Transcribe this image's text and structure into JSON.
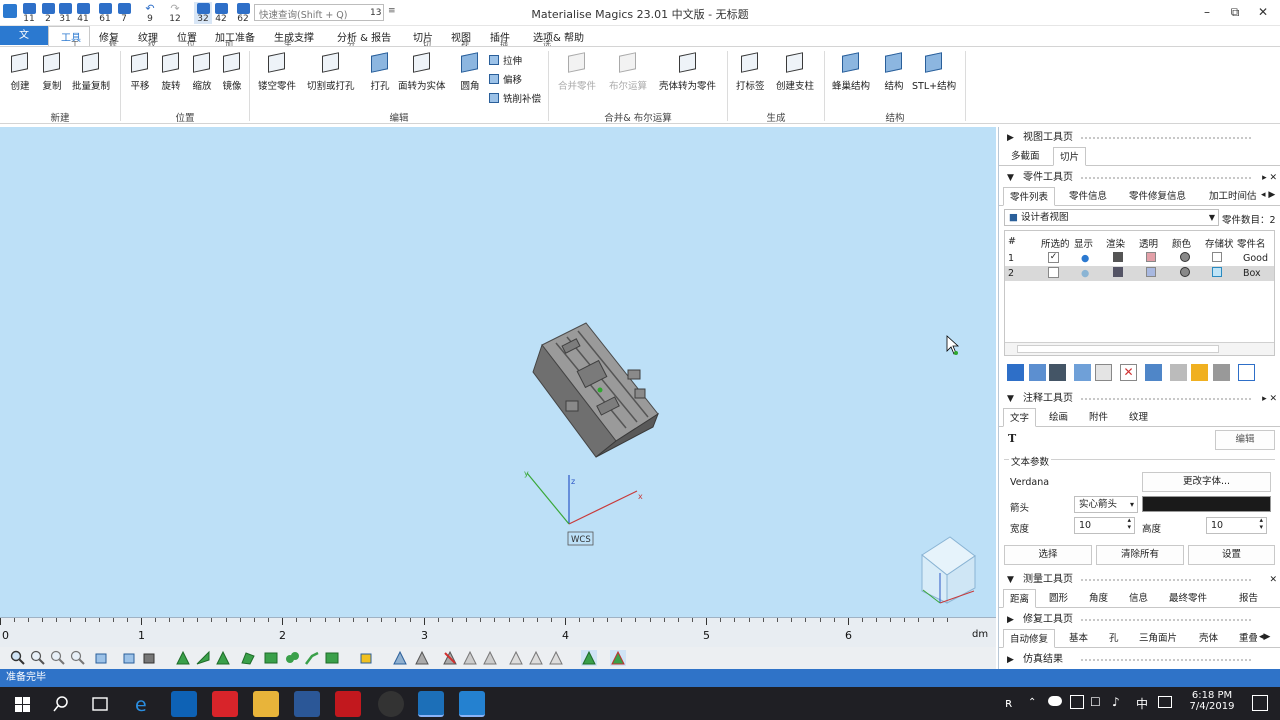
{
  "app": {
    "title": "Materialise Magics 23.01 中文版 - 无标题"
  },
  "quick_access": {
    "badges": [
      "11",
      "2",
      "31",
      "41",
      "61",
      "7",
      "9",
      "12",
      "32",
      "42",
      "62"
    ],
    "search_placeholder": "快速查询(Shift + Q)",
    "search_badge": "13"
  },
  "window_controls": {
    "minimize": "–",
    "restore": "⧉",
    "close": "✕"
  },
  "tabs": [
    {
      "label": "文",
      "accel": ""
    },
    {
      "label": "工具",
      "accel": "工"
    },
    {
      "label": "修复",
      "accel": "修"
    },
    {
      "label": "纹理",
      "accel": "纹"
    },
    {
      "label": "位置",
      "accel": "位"
    },
    {
      "label": "加工准备",
      "accel": "加"
    },
    {
      "label": "生成支撑",
      "accel": "生"
    },
    {
      "label": "分析 & 报告",
      "accel": "分"
    },
    {
      "label": "切片",
      "accel": "切"
    },
    {
      "label": "视图",
      "accel": "视"
    },
    {
      "label": "插件",
      "accel": "插"
    },
    {
      "label": "选项& 帮助",
      "accel": "选"
    }
  ],
  "ribbon": {
    "new_group": {
      "label": "新建",
      "buttons": [
        "创建",
        "复制",
        "批量复制"
      ]
    },
    "position_group": {
      "label": "位置",
      "buttons": [
        "平移",
        "旋转",
        "缩放",
        "镜像"
      ]
    },
    "edit_group": {
      "label": "编辑",
      "buttons": [
        "镂空零件",
        "切割或打孔",
        "打孔",
        "面转为实体",
        "圆角"
      ],
      "small_buttons": [
        "拉伸",
        "偏移",
        "铣削补偿"
      ]
    },
    "merge_group": {
      "label": "合并& 布尔运算",
      "buttons": [
        "合并零件",
        "布尔运算",
        "壳体转为零件"
      ]
    },
    "generate_group": {
      "label": "生成",
      "buttons": [
        "打标签",
        "创建支柱"
      ]
    },
    "structure_group": {
      "label": "结构",
      "buttons": [
        "蜂巢结构",
        "结构",
        "STL+结构"
      ]
    }
  },
  "viewport": {
    "axes": {
      "x": "x",
      "y": "y",
      "z": "z"
    },
    "wcs_label": "WCS",
    "ruler_labels": [
      "0",
      "1",
      "2",
      "3",
      "4",
      "5",
      "6"
    ],
    "ruler_unit": "dm"
  },
  "status": {
    "text": "准备完毕"
  },
  "panel": {
    "view_pages": {
      "title": "视图工具页",
      "tabs": [
        "多截面",
        "切片"
      ]
    },
    "parts_pages": {
      "title": "零件工具页",
      "tabs": [
        "零件列表",
        "零件信息",
        "零件修复信息",
        "加工时间估"
      ],
      "view_select": "设计者视图",
      "count_label": "零件数目：2",
      "columns": [
        "#",
        "所选的",
        "显示",
        "渲染",
        "透明",
        "颜色",
        "存储状",
        "零件名"
      ],
      "rows": [
        {
          "num": "1",
          "checked": "✓",
          "name": "Good"
        },
        {
          "num": "2",
          "checked": "",
          "name": "Box"
        }
      ]
    },
    "annotation_pages": {
      "title": "注释工具页",
      "tabs": [
        "文字",
        "绘画",
        "附件",
        "纹理"
      ],
      "text_tool": "T",
      "edit_button": "编辑",
      "section_label": "文本参数",
      "font_name": "Verdana",
      "change_font_button": "更改字体...",
      "arrow_label": "箭头",
      "arrow_value": "实心箭头",
      "arrow_color": "#1a1a1a",
      "width_label": "宽度",
      "width_value": "10",
      "height_label": "高度",
      "height_value": "10",
      "select_button": "选择",
      "clear_button": "清除所有",
      "settings_button": "设置"
    },
    "measure_pages": {
      "title": "测量工具页",
      "tabs": [
        "距离",
        "圆形",
        "角度",
        "信息",
        "最终零件",
        "报告"
      ]
    },
    "fix_pages": {
      "title": "修复工具页",
      "tabs": [
        "自动修复",
        "基本",
        "孔",
        "三角面片",
        "壳体",
        "重叠"
      ]
    },
    "sim_results": {
      "title": "仿真结果"
    }
  },
  "taskbar": {
    "icons": [
      "windows-start",
      "search",
      "task-view",
      "internet-explorer",
      "outlook",
      "youdao",
      "file-explorer",
      "word",
      "acrobat",
      "media",
      "magics",
      "magics-2"
    ],
    "tray": {
      "ime": "中",
      "time": "6:18 PM",
      "date": "7/4/2019"
    }
  },
  "colors": {
    "accent": "#2b79d0",
    "viewport_bg": "#bde0f7",
    "status_bg": "#2f73c8"
  }
}
